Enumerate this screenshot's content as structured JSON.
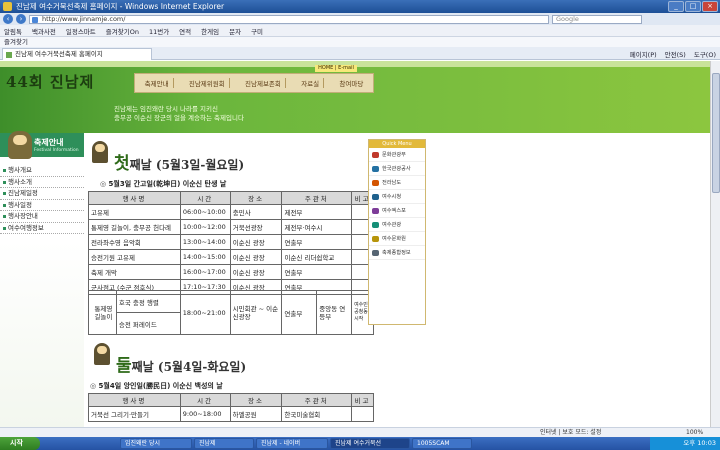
{
  "window": {
    "title": "진남제 여수거북선축제 홈페이지 - Windows Internet Explorer"
  },
  "address": {
    "url": "http://www.jinnamje.com/",
    "search_placeholder": "Google"
  },
  "links_bar": [
    "알림톡",
    "백과사전",
    "일정스마트",
    "즐겨찾기On",
    "11번가",
    "연적",
    "한게임",
    "문자",
    "구미"
  ],
  "favorites_label": "즐겨찾기",
  "tab": {
    "label": "진남제 여수거북선축제 홈페이지"
  },
  "tools": [
    "페이지(P)",
    "안전(S)",
    "도구(O)"
  ],
  "site": {
    "top_mini": "HOME | E-mail",
    "title": "44회 진남제",
    "gnb": [
      "축제안내",
      "진남제위원회",
      "진남제보존회",
      "자료실",
      "참여마당"
    ],
    "slogan_line1": "진남제는 임진왜란 당시 나라를 지키신",
    "slogan_line2": "충무공 이순신 장군의 얼을 계승하는 축제입니다",
    "side_title": "축제안내",
    "side_sub": "Festival Information",
    "side_nav": [
      "행사개요",
      "행사소개",
      "진남제일정",
      "행사일정",
      "행사장안내",
      "여수여행정보"
    ]
  },
  "quick_menu": {
    "header": "Quick Menu",
    "items": [
      {
        "label": "문화관광부",
        "color": "#c0392b"
      },
      {
        "label": "한국관광공사",
        "color": "#2471a3"
      },
      {
        "label": "전라남도",
        "color": "#d35400"
      },
      {
        "label": "여수시청",
        "color": "#1f618d"
      },
      {
        "label": "여수엑스포",
        "color": "#7d3c98"
      },
      {
        "label": "여수관광",
        "color": "#148f77"
      },
      {
        "label": "여수문화원",
        "color": "#b7950b"
      },
      {
        "label": "축제종합정보",
        "color": "#566573"
      }
    ]
  },
  "day1": {
    "first_char": "첫",
    "title_rest": "째날 (5월3일-월요일)",
    "subtitle": "5월3일 간고일(乾坤日) 이순신 탄생 날",
    "headers": [
      "행사명",
      "시간",
      "장소",
      "주관처",
      "비고"
    ],
    "rows": [
      [
        "고유제",
        "06:00~10:00",
        "충민사",
        "제전부",
        ""
      ],
      [
        "통제영 길놀이, 충무공 헌다례",
        "10:00~12:00",
        "거북선광장",
        "제전부·여수시",
        ""
      ],
      [
        "전라좌수영 음악회",
        "13:00~14:00",
        "이순신 광장",
        "연출부",
        ""
      ],
      [
        "승전기원 고유제",
        "14:00~15:00",
        "이순신 광장",
        "이순신 리더쉽학교",
        ""
      ],
      [
        "축제 개막",
        "16:00~17:00",
        "이순신 광장",
        "연출부",
        ""
      ],
      [
        "군사점고 (수군 점호식)",
        "17:10~17:30",
        "이순신 광장",
        "연출부",
        ""
      ]
    ],
    "merged": {
      "label1": "통제영",
      "label2": "길놀이",
      "item1": "호국 충정 행렬",
      "item2": "승전 퍼레이드",
      "time": "18:00~21:00",
      "place": "시민회관 ~ 이순신광장",
      "host": "연출부",
      "host2": "중앙동 연등부",
      "note": "여수민 공청동의 시작"
    }
  },
  "day2": {
    "first_char": "둘",
    "title_rest": "째날 (5월4일-화요일)",
    "subtitle": "5월4일 앙인일(勝民日) 이순신 백성의 날",
    "headers": [
      "행사명",
      "시간",
      "장소",
      "주관처",
      "비고"
    ],
    "rows": [
      [
        "거북선 그리기·만들기",
        "9:00~18:00",
        "하멜공원",
        "한국미술협회",
        ""
      ]
    ]
  },
  "status": {
    "text": "인터넷 | 보호 모드: 설정",
    "zoom": "100%"
  },
  "taskbar": {
    "start": "시작",
    "items": [
      "임진왜란 당시",
      "진남제",
      "진남제 - 네이버",
      "진남제 여수거북선",
      "1005SCAM"
    ],
    "clock": "오후 10:03"
  }
}
